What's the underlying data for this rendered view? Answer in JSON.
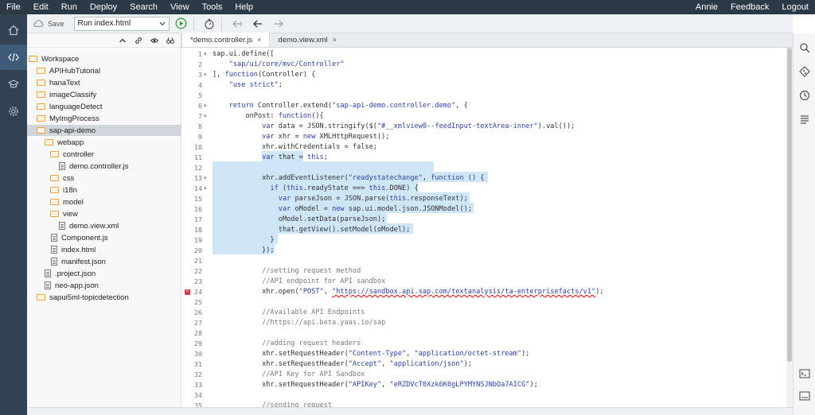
{
  "menu": {
    "items": [
      "File",
      "Edit",
      "Run",
      "Deploy",
      "Search",
      "View",
      "Tools",
      "Help"
    ],
    "user": "Annie",
    "feedback": "Feedback",
    "logout": "Logout"
  },
  "toolbar": {
    "save_label": "Save",
    "run_config": "Run index.html"
  },
  "tabs": [
    {
      "label": "*demo.controller.js",
      "close": "×"
    },
    {
      "label": "demo.view.xml",
      "close": "×"
    }
  ],
  "tree": [
    {
      "label": "Workspace",
      "kind": "folder"
    },
    {
      "label": "APIHubTutorial",
      "kind": "folder"
    },
    {
      "label": "hanaText",
      "kind": "folder"
    },
    {
      "label": "imageClassify",
      "kind": "folder"
    },
    {
      "label": "languageDetect",
      "kind": "folder"
    },
    {
      "label": "MyImgProcess",
      "kind": "folder"
    },
    {
      "label": "sap-api-demo",
      "kind": "folder",
      "selected": true
    },
    {
      "label": "webapp",
      "kind": "folder"
    },
    {
      "label": "controller",
      "kind": "folder"
    },
    {
      "label": "demo.controller.js",
      "kind": "file"
    },
    {
      "label": "css",
      "kind": "folder"
    },
    {
      "label": "i18n",
      "kind": "folder"
    },
    {
      "label": "model",
      "kind": "folder"
    },
    {
      "label": "view",
      "kind": "folder"
    },
    {
      "label": "demo.view.xml",
      "kind": "file"
    },
    {
      "label": "Component.js",
      "kind": "file"
    },
    {
      "label": "index.html",
      "kind": "file"
    },
    {
      "label": "manifest.json",
      "kind": "file"
    },
    {
      "label": ".project.json",
      "kind": "file"
    },
    {
      "label": "neo-app.json",
      "kind": "file"
    },
    {
      "label": "sapui5ml-topicdetection",
      "kind": "folder"
    }
  ],
  "code": [
    {
      "n": "1",
      "fold": true,
      "text": "sap.ui.define(["
    },
    {
      "n": "2",
      "text": "    \"sap/ui/core/mvc/Controller\""
    },
    {
      "n": "3",
      "fold": true,
      "text": "], function(Controller) {"
    },
    {
      "n": "4",
      "text": "    \"use strict\";"
    },
    {
      "n": "5",
      "text": ""
    },
    {
      "n": "6",
      "fold": true,
      "text": "    return Controller.extend(\"sap-api-demo.controller.demo\", {"
    },
    {
      "n": "7",
      "fold": true,
      "text": "        onPost: function(){"
    },
    {
      "n": "8",
      "text": "            var data = JSON.stringify($(\"#__xmlview0--feedInput-textArea-inner\").val());"
    },
    {
      "n": "9",
      "text": "            var xhr = new XMLHttpRequest();"
    },
    {
      "n": "10",
      "text": "            xhr.withCredentials = false;"
    },
    {
      "n": "11",
      "text": "            var that = this;"
    },
    {
      "n": "12",
      "text": ""
    },
    {
      "n": "13",
      "fold": true,
      "text": "            xhr.addEventListener(\"readystatechange\", function () {"
    },
    {
      "n": "14",
      "fold": true,
      "text": "              if (this.readyState === this.DONE) {"
    },
    {
      "n": "15",
      "text": "                var parseJson = JSON.parse(this.responseText);"
    },
    {
      "n": "16",
      "text": "                var oModel = new sap.ui.model.json.JSONModel();"
    },
    {
      "n": "17",
      "text": "                oModel.setData(parseJson);"
    },
    {
      "n": "18",
      "text": "                that.getView().setModel(oModel);"
    },
    {
      "n": "19",
      "text": "              }"
    },
    {
      "n": "20",
      "text": "            });"
    },
    {
      "n": "21",
      "text": ""
    },
    {
      "n": "22",
      "text": "            //setting request method"
    },
    {
      "n": "23",
      "text": "            //API endpoint for API sandbox"
    },
    {
      "n": "24",
      "error": true,
      "text": "            xhr.open(\"POST\", \"https://sandbox.api.sap.com/textanalysis/ta-enterprisefacts/v1\");"
    },
    {
      "n": "25",
      "text": ""
    },
    {
      "n": "26",
      "text": "            //Available API Endpoints"
    },
    {
      "n": "27",
      "text": "            //https://api.beta.yaas.io/sap"
    },
    {
      "n": "28",
      "text": ""
    },
    {
      "n": "29",
      "text": "            //adding request headers"
    },
    {
      "n": "30",
      "text": "            xhr.setRequestHeader(\"Content-Type\", \"application/octet-stream\");"
    },
    {
      "n": "31",
      "text": "            xhr.setRequestHeader(\"Accept\", \"application/json\");"
    },
    {
      "n": "32",
      "text": "            //API Key for API Sandbox"
    },
    {
      "n": "33",
      "text": "            xhr.setRequestHeader(\"APIKey\", \"eRZDVcT0Xzk6K0gLPYMYNSJNbOa7AICG\");"
    },
    {
      "n": "34",
      "text": ""
    },
    {
      "n": "35",
      "text": "            //sending request"
    }
  ]
}
